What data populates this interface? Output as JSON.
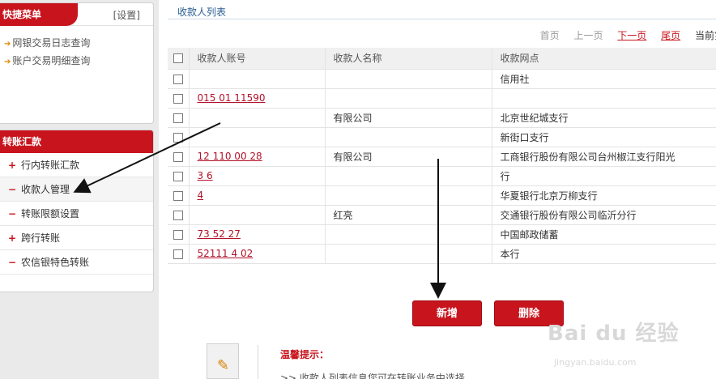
{
  "sidebar": {
    "quick_menu": {
      "title": "快捷菜单",
      "settings": "[设置]",
      "items": [
        "网银交易日志查询",
        "账户交易明细查询"
      ]
    },
    "transfer_menu": {
      "title": "转账汇款",
      "items": [
        {
          "symbol": "+",
          "label": "行内转账汇款"
        },
        {
          "symbol": "−",
          "label": "收款人管理"
        },
        {
          "symbol": "−",
          "label": "转账限额设置"
        },
        {
          "symbol": "+",
          "label": "跨行转账"
        },
        {
          "symbol": "−",
          "label": "农信银特色转账"
        }
      ]
    }
  },
  "main": {
    "breadcrumb": "收款人列表",
    "pager": {
      "first": "首页",
      "prev": "上一页",
      "next": "下一页",
      "last": "尾页",
      "current": "当前第"
    },
    "table": {
      "headers": [
        "收款人账号",
        "收款人名称",
        "收款网点"
      ],
      "rows": [
        {
          "account": "",
          "name": "",
          "branch": "信用社"
        },
        {
          "account": "015 01 11590",
          "name": "",
          "branch": ""
        },
        {
          "account": "",
          "name": "有限公司",
          "branch": "北京世纪城支行"
        },
        {
          "account": "",
          "name": "",
          "branch": "新街口支行"
        },
        {
          "account": "12 110 00 28",
          "name": "有限公司",
          "branch": "工商银行股份有限公司台州椒江支行阳光"
        },
        {
          "account": "3 6",
          "name": "",
          "branch": "行"
        },
        {
          "account": "4",
          "name": "",
          "branch": "华夏银行北京万柳支行"
        },
        {
          "account": "",
          "name": "红亮",
          "branch": "交通银行股份有限公司临沂分行"
        },
        {
          "account": "73 52 27",
          "name": "",
          "branch": "中国邮政储蓄"
        },
        {
          "account": "52111 4 02",
          "name": "",
          "branch": "本行"
        }
      ]
    },
    "buttons": {
      "add": "新增",
      "delete": "删除"
    },
    "tip": {
      "title": "温馨提示：",
      "text": ">> 收款人列表信息您可在转账业务中选择。"
    }
  },
  "watermark": {
    "logo": "Bai du 经验",
    "url": "jingyan.baidu.com"
  },
  "colors": {
    "brand_red": "#c8141d",
    "link_blue": "#2a5d92",
    "account_red": "#b3122a",
    "sidebar_bg": "#eaeaea"
  }
}
